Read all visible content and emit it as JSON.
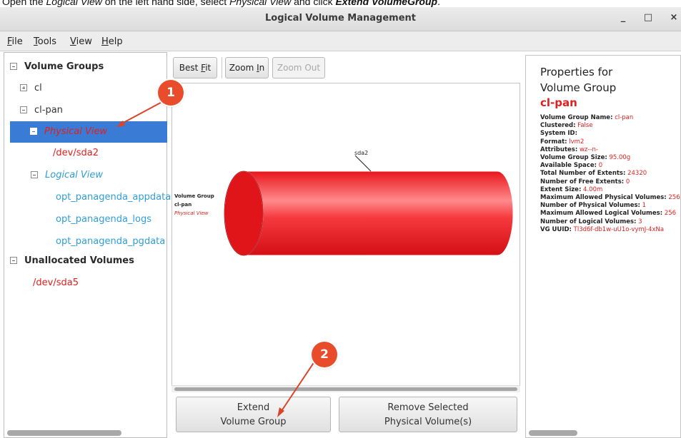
{
  "instruction": {
    "prefix": "Open the ",
    "logical_view": "Logical View",
    "middle": " on the left hand side, select ",
    "physical_view": "Physical View",
    "conjunction": " and click ",
    "extend_vg": "Extend VolumeGroup",
    "suffix": "."
  },
  "window": {
    "title": "Logical Volume Management",
    "min": "_",
    "max": "□",
    "close": "×"
  },
  "menu": [
    {
      "u": "F",
      "rest": "ile"
    },
    {
      "u": "T",
      "rest": "ools"
    },
    {
      "u": "V",
      "rest": "iew"
    },
    {
      "u": "H",
      "rest": "elp"
    }
  ],
  "tree": {
    "volume_groups": "Volume Groups",
    "cl": "cl",
    "cl_pan": "cl-pan",
    "physical_view": "Physical View",
    "sda2": "/dev/sda2",
    "logical_view": "Logical View",
    "lv1": "opt_panagenda_appdata",
    "lv2": "opt_panagenda_logs",
    "lv3": "opt_panagenda_pgdata",
    "unallocated": "Unallocated Volumes",
    "sda5": "/dev/sda5"
  },
  "toolbar": {
    "best_fit": {
      "pre": "Best ",
      "u": "F",
      "post": "it"
    },
    "zoom_in": {
      "pre": "Zoom ",
      "u": "I",
      "post": "n"
    },
    "zoom_out": "Zoom Out"
  },
  "diagram": {
    "disk_label": "sda2",
    "vg_label": "Volume Group",
    "vg_name": "cl-pan",
    "view_name": "Physical View",
    "cylinder_color": "#e8151b"
  },
  "buttons": {
    "extend_line1": "Extend",
    "extend_line2": "Volume Group",
    "remove_line1": "Remove Selected",
    "remove_line2": "Physical Volume(s)"
  },
  "properties": {
    "header1": "Properties for",
    "header2": "Volume Group",
    "name": "cl-pan",
    "rows": [
      {
        "k": "Volume Group Name:",
        "v": "cl-pan"
      },
      {
        "k": "Clustered:",
        "v": "False"
      },
      {
        "k": "System ID:",
        "v": ""
      },
      {
        "k": "Format:",
        "v": "lvm2"
      },
      {
        "k": "Attributes:",
        "v": "wz--n-"
      },
      {
        "k": "Volume Group Size:",
        "v": "95.00g"
      },
      {
        "k": "Available Space:",
        "v": "0"
      },
      {
        "k": "Total Number of Extents:",
        "v": "24320"
      },
      {
        "k": "Number of Free Extents:",
        "v": "0"
      },
      {
        "k": "Extent Size:",
        "v": "4.00m"
      },
      {
        "k": "Maximum Allowed Physical Volumes:",
        "v": "256"
      },
      {
        "k": "Number of Physical Volumes:",
        "v": "1"
      },
      {
        "k": "Maximum Allowed Logical Volumes:",
        "v": "256"
      },
      {
        "k": "Number of Logical Volumes:",
        "v": "3"
      },
      {
        "k": "VG UUID:",
        "v": "Tl3d6f-db1w-uU1o-vymJ-4xNa"
      }
    ]
  },
  "callouts": {
    "one": "1",
    "two": "2"
  },
  "colors": {
    "accent": "#3a7bd5",
    "red": "#e0201f",
    "blue": "#2f9ed8",
    "callout": "#e84c2a"
  }
}
